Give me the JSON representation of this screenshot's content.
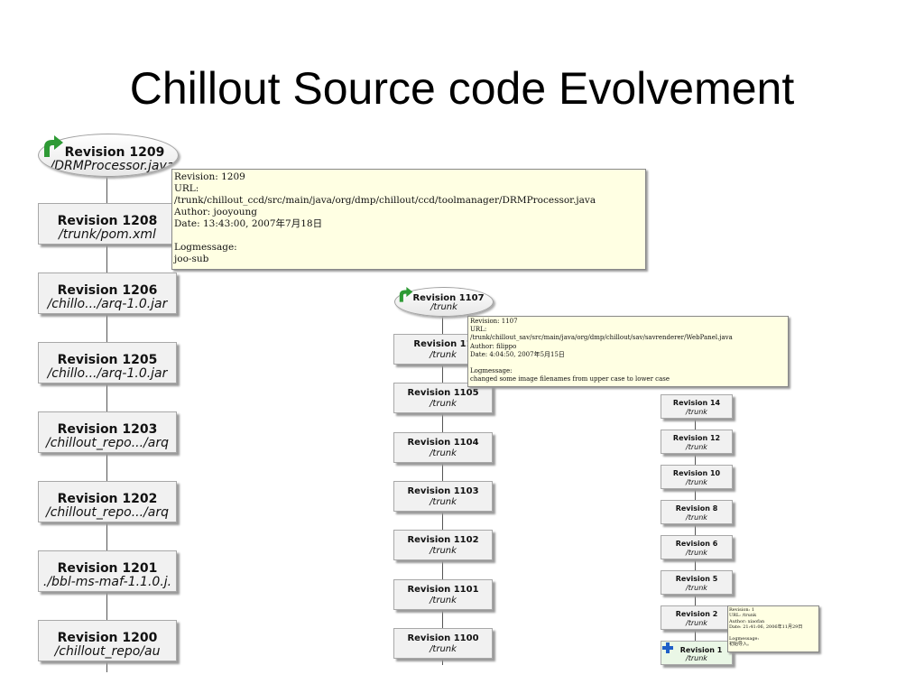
{
  "slide": {
    "title": "Chillout Source code Evolvement"
  },
  "left_graph": {
    "head": {
      "revision": "Revision 1209",
      "path": "../DRMProcessor.java"
    },
    "nodes": [
      {
        "revision": "Revision 1208",
        "path": "/trunk/pom.xml"
      },
      {
        "revision": "Revision 1206",
        "path": "/chillo.../arq-1.0.jar"
      },
      {
        "revision": "Revision 1205",
        "path": "/chillo.../arq-1.0.jar"
      },
      {
        "revision": "Revision 1203",
        "path": "/chillout_repo.../arq"
      },
      {
        "revision": "Revision 1202",
        "path": "/chillout_repo.../arq"
      },
      {
        "revision": "Revision 1201",
        "path": "./bbl-ms-maf-1.1.0.j."
      },
      {
        "revision": "Revision 1200",
        "path": "/chillout_repo/au"
      }
    ],
    "tooltip": {
      "lines": [
        "Revision: 1209",
        "URL:",
        "/trunk/chillout_ccd/src/main/java/org/dmp/chillout/ccd/toolmanager/DRMProcessor.java",
        "Author: jooyoung",
        "Date: 13:43:00, 2007年7月18日",
        "",
        "Logmessage:",
        "joo-sub"
      ]
    }
  },
  "middle_graph": {
    "head": {
      "revision": "Revision 1107",
      "path": "/trunk"
    },
    "nodes": [
      {
        "revision": "Revision 11",
        "path": "/trunk"
      },
      {
        "revision": "Revision 1105",
        "path": "/trunk"
      },
      {
        "revision": "Revision 1104",
        "path": "/trunk"
      },
      {
        "revision": "Revision 1103",
        "path": "/trunk"
      },
      {
        "revision": "Revision 1102",
        "path": "/trunk"
      },
      {
        "revision": "Revision 1101",
        "path": "/trunk"
      },
      {
        "revision": "Revision 1100",
        "path": "/trunk"
      }
    ],
    "tooltip": {
      "lines": [
        "Revision: 1107",
        "URL:",
        "/trunk/chillout_sav/src/main/java/org/dmp/chillout/sav/savrenderer/WebPanel.java",
        "Author: filippo",
        "Date: 4:04:50, 2007年5月15日",
        "",
        "Logmessage:",
        "changed some image filenames from upper case to lower case"
      ]
    }
  },
  "right_graph": {
    "nodes": [
      {
        "revision": "Revision 14",
        "path": "/trunk"
      },
      {
        "revision": "Revision 12",
        "path": "/trunk"
      },
      {
        "revision": "Revision 10",
        "path": "/trunk"
      },
      {
        "revision": "Revision 8",
        "path": "/trunk"
      },
      {
        "revision": "Revision 6",
        "path": "/trunk"
      },
      {
        "revision": "Revision 5",
        "path": "/trunk"
      },
      {
        "revision": "Revision 2",
        "path": "/trunk"
      }
    ],
    "first": {
      "revision": "Revision 1",
      "path": "/trunk"
    },
    "tooltip": {
      "lines": [
        "Revision: 1",
        "URL: /trunk",
        "Author: xiaofan",
        "Date: 21:41:06, 2006年11月29日",
        "",
        "Logmessage:",
        "初始导入。"
      ]
    }
  },
  "colors": {
    "arrow": "#2e9a35",
    "plus": "#1f5fc8",
    "first_node_bg": "#eaf7e6",
    "tooltip_bg": "#ffffe3"
  }
}
